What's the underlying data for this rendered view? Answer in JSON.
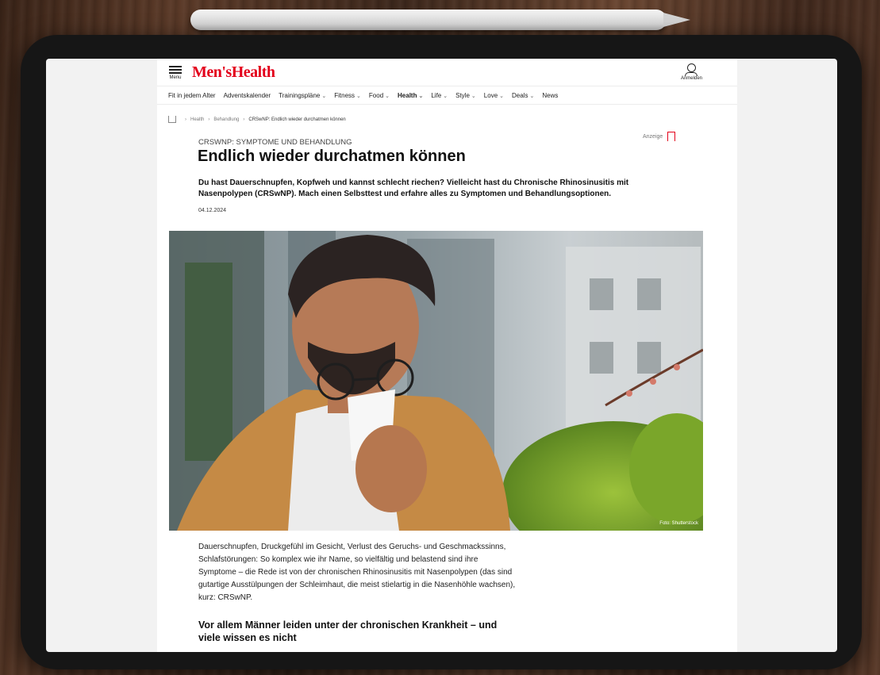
{
  "header": {
    "menu_label": "Menu",
    "logo": "Men'sHealth",
    "login_label": "Anmelden"
  },
  "nav": {
    "items": [
      {
        "label": "Fit in jedem Alter",
        "chevron": false,
        "bold": false
      },
      {
        "label": "Adventskalender",
        "chevron": false,
        "bold": false
      },
      {
        "label": "Trainingspläne",
        "chevron": true,
        "bold": false
      },
      {
        "label": "Fitness",
        "chevron": true,
        "bold": false
      },
      {
        "label": "Food",
        "chevron": true,
        "bold": false
      },
      {
        "label": "Health",
        "chevron": true,
        "bold": true
      },
      {
        "label": "Life",
        "chevron": true,
        "bold": false
      },
      {
        "label": "Style",
        "chevron": true,
        "bold": false
      },
      {
        "label": "Love",
        "chevron": true,
        "bold": false
      },
      {
        "label": "Deals",
        "chevron": true,
        "bold": false
      },
      {
        "label": "News",
        "chevron": false,
        "bold": false
      }
    ]
  },
  "breadcrumb": {
    "items": [
      "Health",
      "Behandlung",
      "CRSwNP: Endlich wieder durchatmen können"
    ]
  },
  "article": {
    "ad_label": "Anzeige",
    "kicker": "CRSWNP: SYMPTOME UND BEHANDLUNG",
    "title": "Endlich wieder durchatmen können",
    "lead": "Du hast Dauerschnupfen, Kopfweh und kannst schlecht riechen? Vielleicht hast du Chronische Rhinosinusitis mit Nasenpolypen (CRSwNP). Mach einen Selbsttest und erfahre alles zu Symptomen und Behandlungsoptionen.",
    "date": "04.12.2024",
    "image_credit": "Foto: Shutterstock",
    "body": "Dauerschnupfen, Druckgefühl im Gesicht, Verlust des Geruchs- und Geschmackssinns, Schlafstörungen: So komplex wie ihr Name, so vielfältig und belastend sind ihre Symptome – die Rede ist von der chronischen Rhinosinusitis mit Nasenpolypen (das sind gutartige Ausstülpungen der Schleimhaut, die meist stielartig in die Nasenhöhle wachsen), kurz: CRSwNP.",
    "subhead": "Vor allem Männer leiden unter der chronischen Krankheit – und viele wissen es nicht"
  },
  "colors": {
    "brand": "#e3001b",
    "text": "#111111"
  }
}
